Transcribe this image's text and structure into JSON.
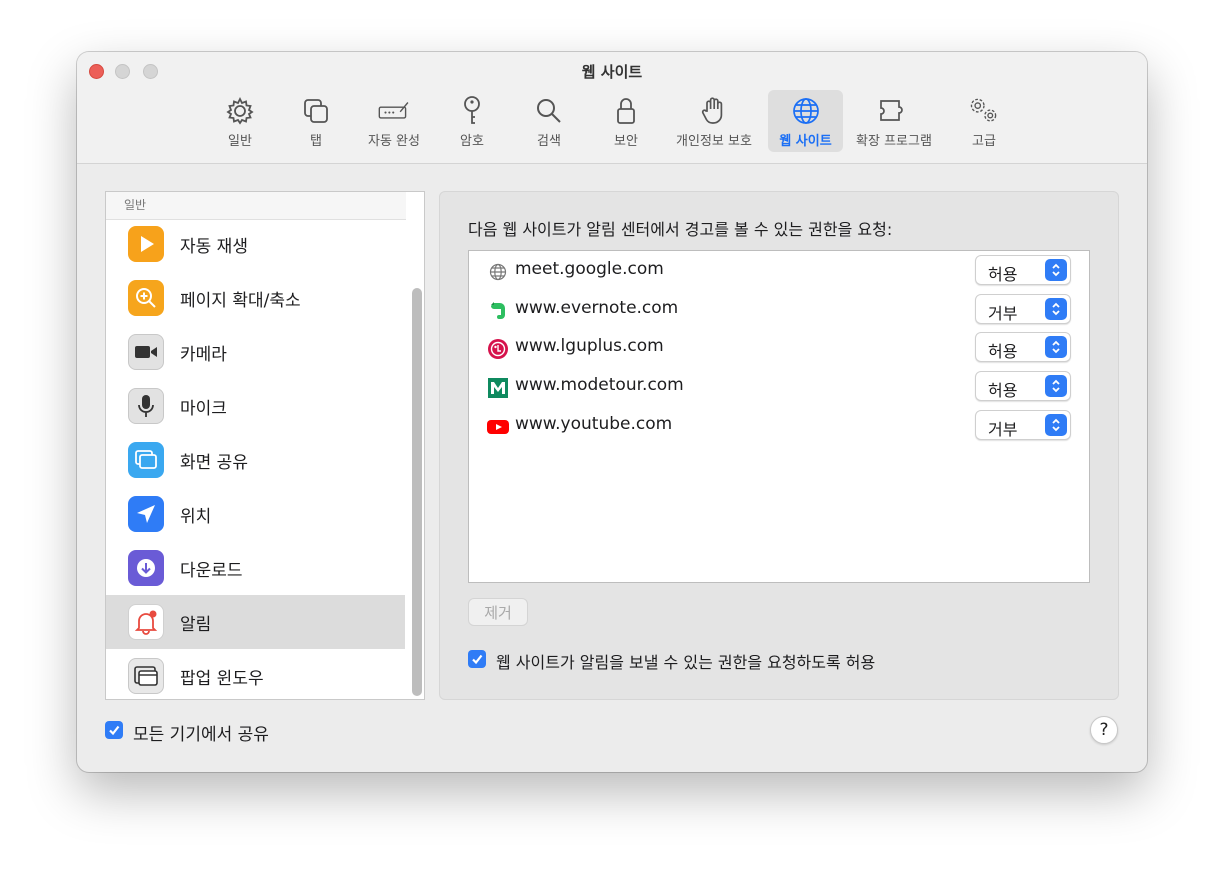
{
  "window": {
    "title": "웹 사이트"
  },
  "toolbar": {
    "tabs": [
      {
        "label": "일반",
        "icon": "gear-icon"
      },
      {
        "label": "탭",
        "icon": "tabs-icon"
      },
      {
        "label": "자동 완성",
        "icon": "autofill-icon"
      },
      {
        "label": "암호",
        "icon": "key-icon"
      },
      {
        "label": "검색",
        "icon": "search-icon"
      },
      {
        "label": "보안",
        "icon": "lock-icon"
      },
      {
        "label": "개인정보 보호",
        "icon": "hand-icon"
      },
      {
        "label": "웹 사이트",
        "icon": "globe-icon",
        "selected": true
      },
      {
        "label": "확장 프로그램",
        "icon": "puzzle-icon"
      },
      {
        "label": "고급",
        "icon": "gears-icon"
      }
    ]
  },
  "sidebar": {
    "section_header": "일반",
    "items": [
      {
        "label": "자동 재생",
        "icon": "play-icon"
      },
      {
        "label": "페이지 확대/축소",
        "icon": "zoom-icon"
      },
      {
        "label": "카메라",
        "icon": "camera-icon"
      },
      {
        "label": "마이크",
        "icon": "microphone-icon"
      },
      {
        "label": "화면 공유",
        "icon": "screen-share-icon"
      },
      {
        "label": "위치",
        "icon": "location-icon"
      },
      {
        "label": "다운로드",
        "icon": "download-icon"
      },
      {
        "label": "알림",
        "icon": "notification-bell-icon",
        "selected": true
      },
      {
        "label": "팝업 윈도우",
        "icon": "popup-window-icon"
      }
    ]
  },
  "panel": {
    "description": "다음 웹 사이트가 알림 센터에서 경고를 볼 수 있는 권한을 요청:",
    "sites": [
      {
        "domain": "meet.google.com",
        "permission": "허용",
        "favicon": "globe-favicon"
      },
      {
        "domain": "www.evernote.com",
        "permission": "거부",
        "favicon": "evernote-favicon"
      },
      {
        "domain": "www.lguplus.com",
        "permission": "허용",
        "favicon": "lguplus-favicon"
      },
      {
        "domain": "www.modetour.com",
        "permission": "허용",
        "favicon": "modetour-favicon"
      },
      {
        "domain": "www.youtube.com",
        "permission": "거부",
        "favicon": "youtube-favicon"
      }
    ],
    "remove_label": "제거",
    "allow_requests_label": "웹 사이트가 알림을 보낼 수 있는 권한을 요청하도록 허용",
    "allow_requests_checked": true
  },
  "footer": {
    "share_label": "모든 기기에서 공유",
    "share_checked": true,
    "help_label": "?"
  },
  "colors": {
    "accent": "#2f7cf6",
    "close": "#ec5f58"
  }
}
